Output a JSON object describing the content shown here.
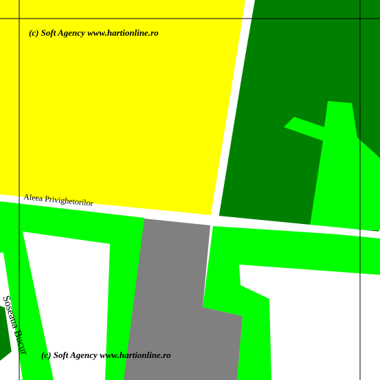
{
  "map": {
    "watermark_top": "(c) Soft Agency www.hartionline.ro",
    "watermark_bottom": "(c) Soft Agency www.hartionline.ro",
    "streets": {
      "aleea": "Aleea Privighetorilor",
      "soseaua": "Soseaua Bucur"
    },
    "colors": {
      "residential": "#ffff00",
      "forest": "#008000",
      "park": "#00ff00",
      "industrial": "#808080",
      "road": "#ffffff",
      "grid": "#000000"
    }
  }
}
